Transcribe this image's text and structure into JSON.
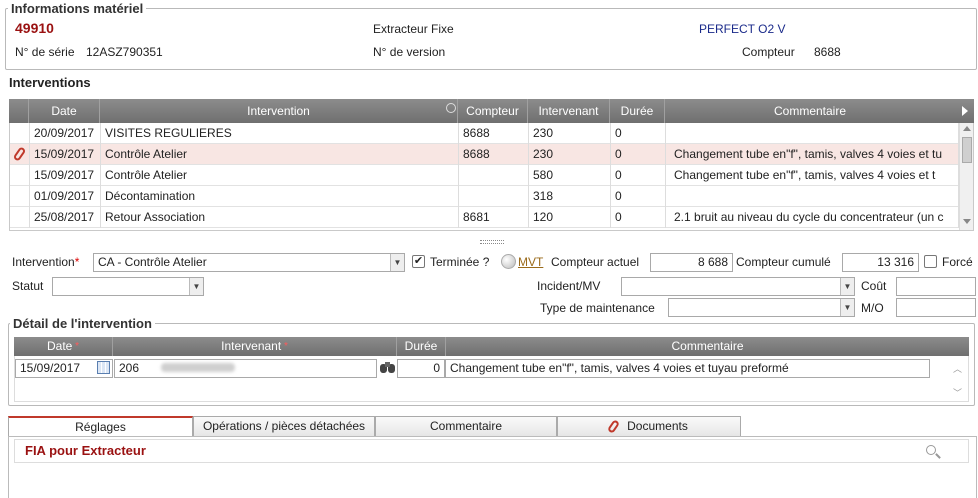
{
  "materiel": {
    "legend": "Informations matériel",
    "code": "49910",
    "type": "Extracteur Fixe",
    "model": "PERFECT O2 V",
    "serie_label": "N° de série",
    "serie_value": "12ASZ790351",
    "version_label": "N° de version",
    "compteur_label": "Compteur",
    "compteur_value": "8688"
  },
  "interventions": {
    "title": "Interventions",
    "columns": [
      "Date",
      "Intervention",
      "Compteur",
      "Intervenant",
      "Durée",
      "Commentaire"
    ],
    "rows": [
      {
        "date": "20/09/2017",
        "intervention": "VISITES REGULIERES",
        "compteur": "8688",
        "intervenant": "230",
        "duree": "0",
        "commentaire": "",
        "attach": false
      },
      {
        "date": "15/09/2017",
        "intervention": "Contrôle Atelier",
        "compteur": "8688",
        "intervenant": "230",
        "duree": "0",
        "commentaire": "Changement tube en\"f\", tamis, valves 4 voies et tu",
        "attach": true
      },
      {
        "date": "15/09/2017",
        "intervention": "Contrôle Atelier",
        "compteur": "",
        "intervenant": "580",
        "duree": "0",
        "commentaire": "Changement tube en\"f\", tamis, valves 4 voies et t",
        "attach": false
      },
      {
        "date": "01/09/2017",
        "intervention": "Décontamination",
        "compteur": "",
        "intervenant": "318",
        "duree": "0",
        "commentaire": "",
        "attach": false
      },
      {
        "date": "25/08/2017",
        "intervention": "Retour Association",
        "compteur": "8681",
        "intervenant": "120",
        "duree": "0",
        "commentaire": "2.1 bruit au niveau du cycle du concentrateur (un c",
        "attach": false
      }
    ]
  },
  "form": {
    "intervention_label": "Intervention",
    "intervention_value": "CA - Contrôle Atelier",
    "terminee_label": "Terminée ?",
    "mvt_label": "MVT",
    "compteur_actuel_label": "Compteur actuel",
    "compteur_actuel_value": "8 688",
    "compteur_cumule_label": "Compteur cumulé",
    "compteur_cumule_value": "13 316",
    "force_label": "Forcé",
    "statut_label": "Statut",
    "statut_value": "",
    "incident_label": "Incident/MV",
    "incident_value": "",
    "cout_label": "Coût",
    "cout_value": "",
    "maintenance_label": "Type de maintenance",
    "maintenance_value": "",
    "mo_label": "M/O",
    "mo_value": ""
  },
  "detail": {
    "legend": "Détail de l'intervention",
    "columns": [
      "Date",
      "Intervenant",
      "Durée",
      "Commentaire"
    ],
    "row": {
      "date": "15/09/2017",
      "intervenant_code": "206",
      "duree": "0",
      "commentaire": "Changement tube en\"f\", tamis, valves 4 voies et tuyau preformé"
    }
  },
  "tabs": [
    "Réglages",
    "Opérations / pièces détachées",
    "Commentaire",
    "Documents"
  ],
  "panel": {
    "title": "FIA pour Extracteur"
  },
  "colors": {
    "accent_red": "#9a1111",
    "model_blue": "#1a2a8a",
    "header_gray": "#7d7d7d",
    "selected_row": "#f8e6e3"
  }
}
